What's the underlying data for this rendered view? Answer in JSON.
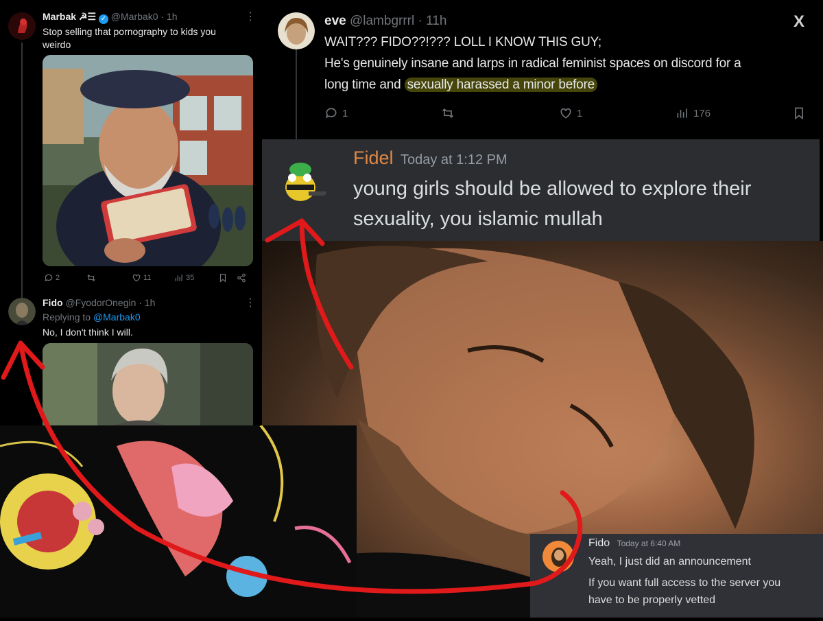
{
  "tweet1": {
    "name": "Marbak ☭☰",
    "handle": "@Marbak0 · 1h",
    "text": "Stop selling that pornography to kids you weirdo",
    "replies": "2",
    "likes": "11",
    "views": "35"
  },
  "tweet2": {
    "name": "Fido",
    "handle": "@FyodorOnegin · 1h",
    "replying_prefix": "Replying to ",
    "replying_to": "@Marbak0",
    "text": "No, I don't think I will."
  },
  "eve_tweet": {
    "name": "eve",
    "handle": "@lambgrrrl · 11h",
    "line1": "WAIT??? FIDO??!??? LOLL I KNOW THIS GUY;",
    "line2": "He's genuinely insane and larps in radical feminist spaces on discord for a",
    "line3_pre": "long time and ",
    "line3_highlight": "sexually harassed a minor before",
    "replies": "1",
    "likes": "1",
    "views": "176",
    "logo": "X"
  },
  "discord_top": {
    "username": "Fidel",
    "timestamp": "Today at 1:12 PM",
    "message_line1": "young girls should be allowed to explore their",
    "message_line2": "sexuality, you islamic mullah"
  },
  "discord_bottom": {
    "username": "Fido",
    "timestamp": "Today at 6:40 AM",
    "message1": "Yeah, I just did an announcement",
    "message2_line1": "If you want full access to the server you",
    "message2_line2": "have to be properly vetted"
  },
  "colors": {
    "twitter_bg": "#000000",
    "twitter_link": "#1d9bf0",
    "discord_bg": "#2b2d31",
    "discord_name_orange": "#e08846",
    "arrow_red": "#e0191b",
    "highlight": "#808014"
  },
  "icons": [
    "reply-icon",
    "retweet-icon",
    "like-icon",
    "views-icon",
    "bookmark-icon",
    "share-icon",
    "verified-icon",
    "more-icon"
  ]
}
